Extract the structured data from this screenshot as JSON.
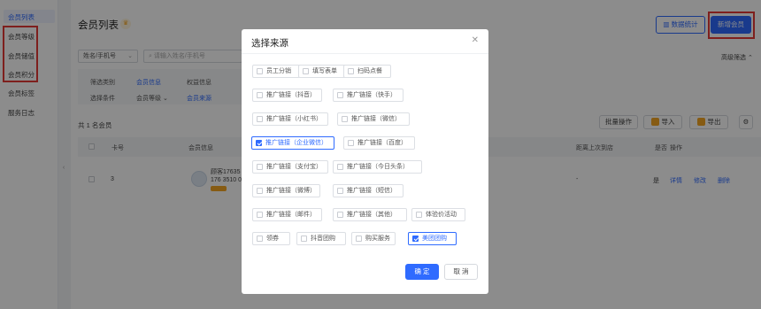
{
  "sidebar": {
    "items": [
      {
        "label": "会员列表"
      },
      {
        "label": "会员等级"
      },
      {
        "label": "会员储值"
      },
      {
        "label": "会员积分"
      },
      {
        "label": "会员标签"
      },
      {
        "label": "服务日志"
      }
    ]
  },
  "header": {
    "title": "会员列表",
    "data_stats_label": "数据统计",
    "add_member_label": "新增会员"
  },
  "search": {
    "field_select": "姓名/手机号",
    "input_placeholder": "请输入姓名/手机号",
    "advanced_filter": "高级筛选"
  },
  "filter": {
    "row1_label": "筛选类别",
    "row1_tab1": "会员信息",
    "row1_tab2": "权益信息",
    "row2_label": "选择条件",
    "row2_select": "会员等级",
    "row2_tab2": "会员来源"
  },
  "summary": {
    "count_text": "共 1 名会员"
  },
  "toolbar": {
    "batch": "批量操作",
    "import": "导入",
    "export": "导出"
  },
  "table": {
    "headers": {
      "card_no": "卡号",
      "member_info": "会员信息",
      "last_visit": "距离上次到店",
      "col_partial": "是否",
      "ops": "操作"
    },
    "row": {
      "card_no": "3",
      "name": "顾客17635",
      "phone": "176 3510 0",
      "last_visit": "-",
      "partial": "是",
      "op_detail": "详情",
      "op_edit": "修改",
      "op_delete": "删除"
    }
  },
  "modal": {
    "title": "选择来源",
    "confirm": "确 定",
    "cancel": "取 消",
    "options": [
      {
        "label": "员工分销",
        "checked": false
      },
      {
        "label": "填写表单",
        "checked": false
      },
      {
        "label": "扫码点餐",
        "checked": false
      },
      {
        "label": "推广链接（抖音）",
        "checked": false
      },
      {
        "label": "推广链接（快手）",
        "checked": false
      },
      {
        "label": "推广链接（小红书）",
        "checked": false
      },
      {
        "label": "推广链接（微信）",
        "checked": false
      },
      {
        "label": "推广链接（企业微信）",
        "checked": true
      },
      {
        "label": "推广链接（百度）",
        "checked": false
      },
      {
        "label": "推广链接（支付宝）",
        "checked": false
      },
      {
        "label": "推广链接（今日头条）",
        "checked": false
      },
      {
        "label": "推广链接（微博）",
        "checked": false
      },
      {
        "label": "推广链接（短信）",
        "checked": false
      },
      {
        "label": "推广链接（邮件）",
        "checked": false
      },
      {
        "label": "推广链接（其他）",
        "checked": false
      },
      {
        "label": "体验价活动",
        "checked": false
      },
      {
        "label": "领券",
        "checked": false
      },
      {
        "label": "抖音团购",
        "checked": false
      },
      {
        "label": "购买服务",
        "checked": false
      },
      {
        "label": "美团团购",
        "checked": true
      }
    ]
  },
  "colors": {
    "primary": "#2f6bff",
    "highlight": "#e53935",
    "accent": "#f5a623"
  }
}
